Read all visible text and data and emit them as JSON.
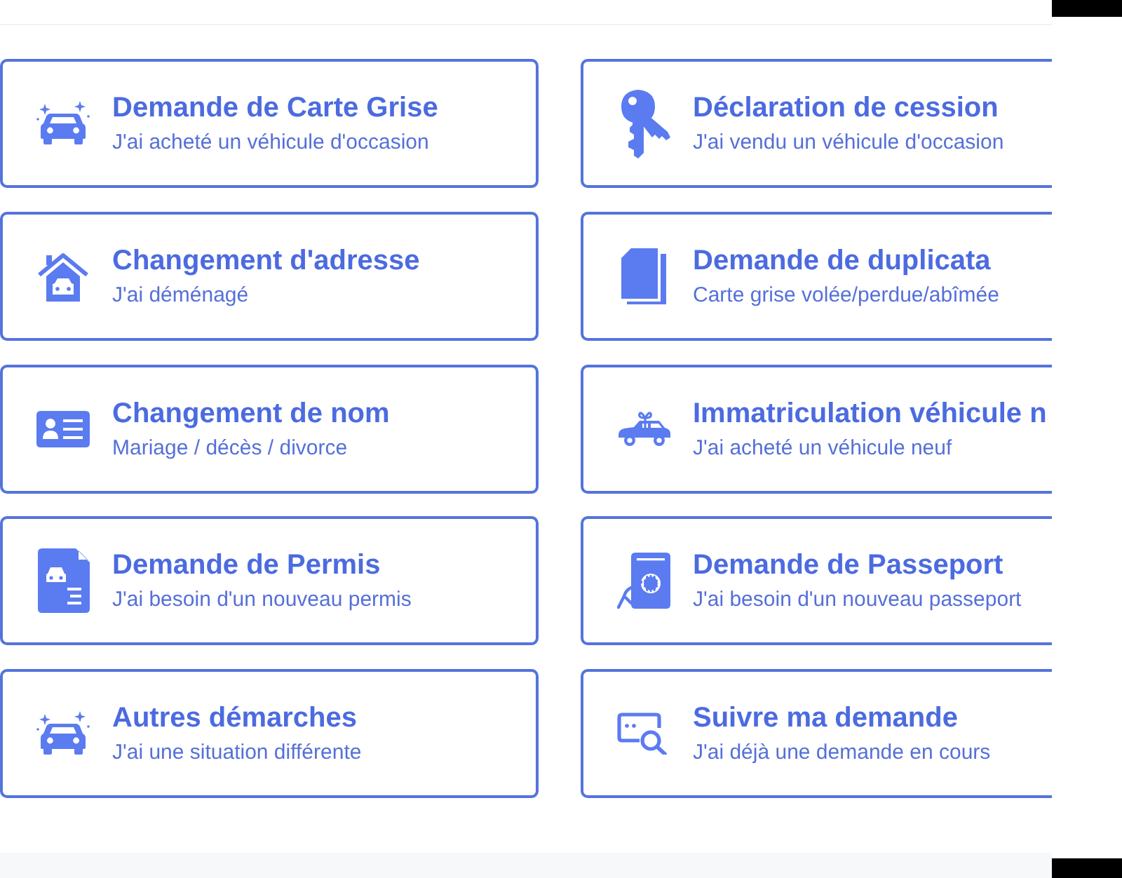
{
  "cards": [
    {
      "kind": "car",
      "title": "Demande de Carte Grise",
      "subtitle": "J'ai acheté un véhicule d'occasion"
    },
    {
      "kind": "keys",
      "title": "Déclaration de cession",
      "subtitle": "J'ai vendu un véhicule d'occasion"
    },
    {
      "kind": "house",
      "title": "Changement d'adresse",
      "subtitle": "J'ai déménagé"
    },
    {
      "kind": "copies",
      "title": "Demande de duplicata",
      "subtitle": "Carte grise volée/perdue/abîmée"
    },
    {
      "kind": "idcard",
      "title": "Changement de nom",
      "subtitle": "Mariage / décès / divorce"
    },
    {
      "kind": "giftcar",
      "title": "Immatriculation véhicule n",
      "subtitle": "J'ai acheté un véhicule neuf"
    },
    {
      "kind": "permit",
      "title": "Demande de Permis",
      "subtitle": "J'ai besoin d'un nouveau permis"
    },
    {
      "kind": "passport",
      "title": "Demande de Passeport",
      "subtitle": "J'ai besoin d'un nouveau passeport"
    },
    {
      "kind": "car",
      "title": "Autres démarches",
      "subtitle": "J'ai une situation différente"
    },
    {
      "kind": "tracking",
      "title": "Suivre ma demande",
      "subtitle": "J'ai déjà une demande en cours"
    }
  ]
}
